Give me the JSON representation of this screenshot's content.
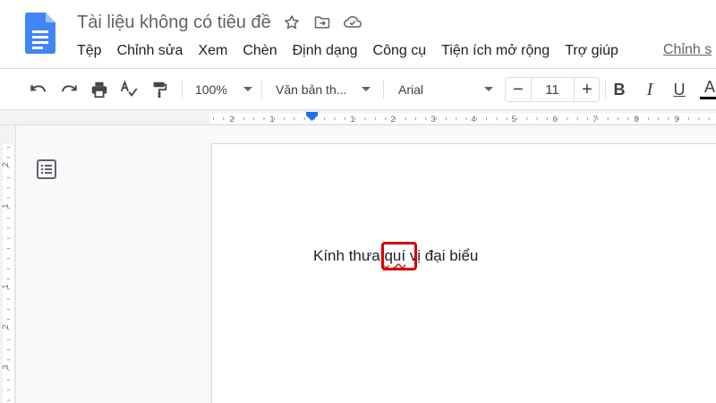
{
  "header": {
    "doc_title": "Tài liệu không có tiêu đề",
    "menus": [
      "Tệp",
      "Chỉnh sửa",
      "Xem",
      "Chèn",
      "Định dạng",
      "Công cụ",
      "Tiện ích mở rộng",
      "Trợ giúp"
    ],
    "edit_mode_label": "Chỉnh s"
  },
  "toolbar": {
    "zoom": "100%",
    "style": "Văn bản th...",
    "font": "Arial",
    "font_size": "11",
    "minus": "−",
    "plus": "+",
    "bold": "B",
    "italic": "I",
    "underline": "U",
    "text_color": "A"
  },
  "ruler": {
    "h_labels": [
      "2",
      "1",
      "1",
      "2",
      "3",
      "4",
      "5",
      "6",
      "7",
      "8",
      "9"
    ],
    "v_labels": [
      "2",
      "1",
      "1",
      "2",
      "3"
    ]
  },
  "document": {
    "text_before": "Kính thưa ",
    "text_misspelled": "quí",
    "text_after": " vị đại biểu"
  },
  "colors": {
    "brand": "#4285f4",
    "highlight": "#d50000",
    "ruler_marker": "#1a73e8"
  }
}
